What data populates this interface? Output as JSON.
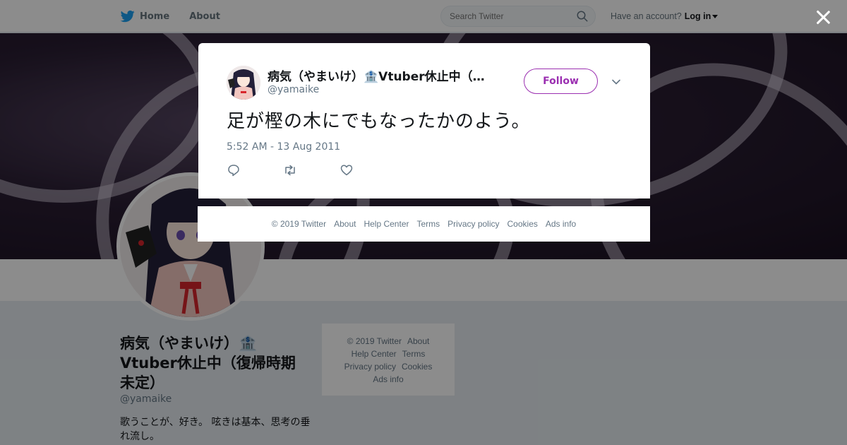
{
  "topbar": {
    "home_label": "Home",
    "about_label": "About",
    "search_placeholder": "Search Twitter",
    "account_prompt": "Have an account?",
    "login_label": "Log in"
  },
  "profile": {
    "name": "病気（やまいけ）🏦Vtuber休止中（復帰時期未定）",
    "handle": "@yamaike",
    "bio": "歌うことが、好き。 呟きは基本、思考の垂れ流し。"
  },
  "side_footer": {
    "copyright": "© 2019 Twitter",
    "about": "About",
    "help": "Help Center",
    "terms": "Terms",
    "privacy": "Privacy policy",
    "cookies": "Cookies",
    "ads": "Ads info"
  },
  "tweet": {
    "author_name": "病気（やまいけ）🏦Vtuber休止中（復帰時期未定）",
    "author_handle": "@yamaike",
    "follow_label": "Follow",
    "text": "足が樫の木にでもなったかのよう。",
    "timestamp": "5:52 AM - 13 Aug 2011"
  },
  "modal_footer": {
    "copyright": "© 2019 Twitter",
    "about": "About",
    "help": "Help Center",
    "terms": "Terms",
    "privacy": "Privacy policy",
    "cookies": "Cookies",
    "ads": "Ads info"
  },
  "colors": {
    "twitter_blue": "#1da1f2",
    "follow_accent": "#9b2fb1",
    "secondary_text": "#657786"
  },
  "icons": [
    "twitter-bird-icon",
    "search-icon",
    "caret-down-icon",
    "close-icon",
    "chevron-down-icon",
    "reply-icon",
    "retweet-icon",
    "like-icon"
  ]
}
